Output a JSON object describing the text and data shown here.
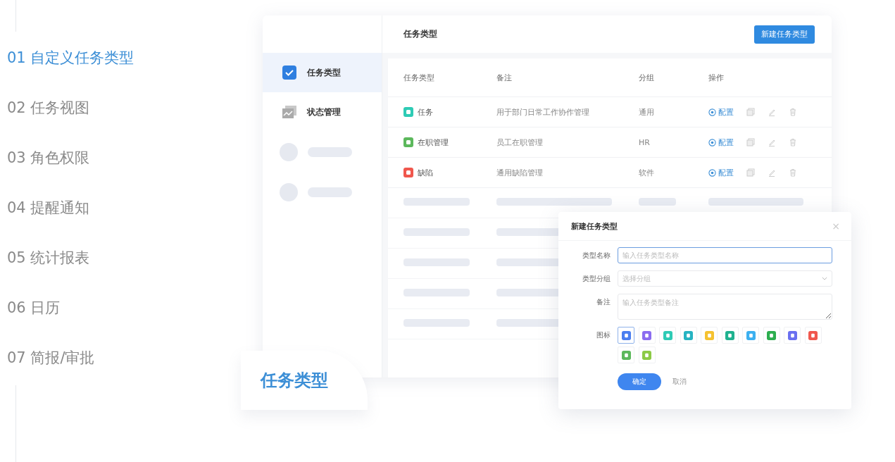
{
  "features": [
    {
      "number": "01",
      "label": "自定义任务类型",
      "selected": true
    },
    {
      "number": "02",
      "label": "任务视图",
      "selected": false
    },
    {
      "number": "03",
      "label": "角色权限",
      "selected": false
    },
    {
      "number": "04",
      "label": "提醒通知",
      "selected": false
    },
    {
      "number": "05",
      "label": "统计报表",
      "selected": false
    },
    {
      "number": "06",
      "label": "日历",
      "selected": false
    },
    {
      "number": "07",
      "label": "简报/审批",
      "selected": false
    }
  ],
  "mockup": {
    "sidebar": {
      "items": [
        {
          "kind": "check",
          "label": "任务类型",
          "selected": true
        },
        {
          "kind": "chart",
          "label": "状态管理",
          "selected": false
        },
        {
          "kind": "skeleton"
        },
        {
          "kind": "skeleton"
        }
      ]
    },
    "header": {
      "title": "任务类型",
      "button": "新建任务类型"
    },
    "table": {
      "columns": [
        "任务类型",
        "备注",
        "分组",
        "操作"
      ],
      "rows": [
        {
          "kind": "data",
          "color": "#2ecbb5",
          "name": "任务",
          "note": "用于部门日常工作协作管理",
          "group": "通用",
          "action": "配置"
        },
        {
          "kind": "data",
          "color": "#5cb85c",
          "name": "在职管理",
          "note": "员工在职管理",
          "group": "HR",
          "action": "配置"
        },
        {
          "kind": "data",
          "color": "#f0574d",
          "name": "缺陷",
          "note": "通用缺陷管理",
          "group": "软件",
          "action": "配置"
        },
        {
          "kind": "skeleton"
        },
        {
          "kind": "partial"
        },
        {
          "kind": "partial"
        },
        {
          "kind": "partial"
        },
        {
          "kind": "partial"
        }
      ]
    },
    "dialog": {
      "title": "新建任务类型",
      "close": "×",
      "fields": [
        {
          "kind": "text",
          "label": "类型名称",
          "placeholder": "输入任务类型名称",
          "focused": true
        },
        {
          "kind": "select",
          "label": "类型分组",
          "placeholder": "选择分组",
          "focused": false
        },
        {
          "kind": "textarea",
          "label": "备注",
          "placeholder": "输入任务类型备注",
          "focused": false
        }
      ],
      "icon_label": "图标",
      "icons": [
        {
          "color": "#4a7ef0",
          "selected": true
        },
        {
          "color": "#8b6cf0",
          "selected": false
        },
        {
          "color": "#2ecbb5",
          "selected": false
        },
        {
          "color": "#26b3c2",
          "selected": false
        },
        {
          "color": "#f5c230",
          "selected": false
        },
        {
          "color": "#1fb18f",
          "selected": false
        },
        {
          "color": "#3cb0f0",
          "selected": false
        },
        {
          "color": "#2dae4f",
          "selected": false
        },
        {
          "color": "#6a70f0",
          "selected": false
        },
        {
          "color": "#f0574d",
          "selected": false
        },
        {
          "color": "#5cb85c",
          "selected": false
        },
        {
          "color": "#8cca45",
          "selected": false
        }
      ],
      "confirm": "确定",
      "cancel": "取消"
    },
    "badge": {
      "label": "任务类型"
    }
  }
}
